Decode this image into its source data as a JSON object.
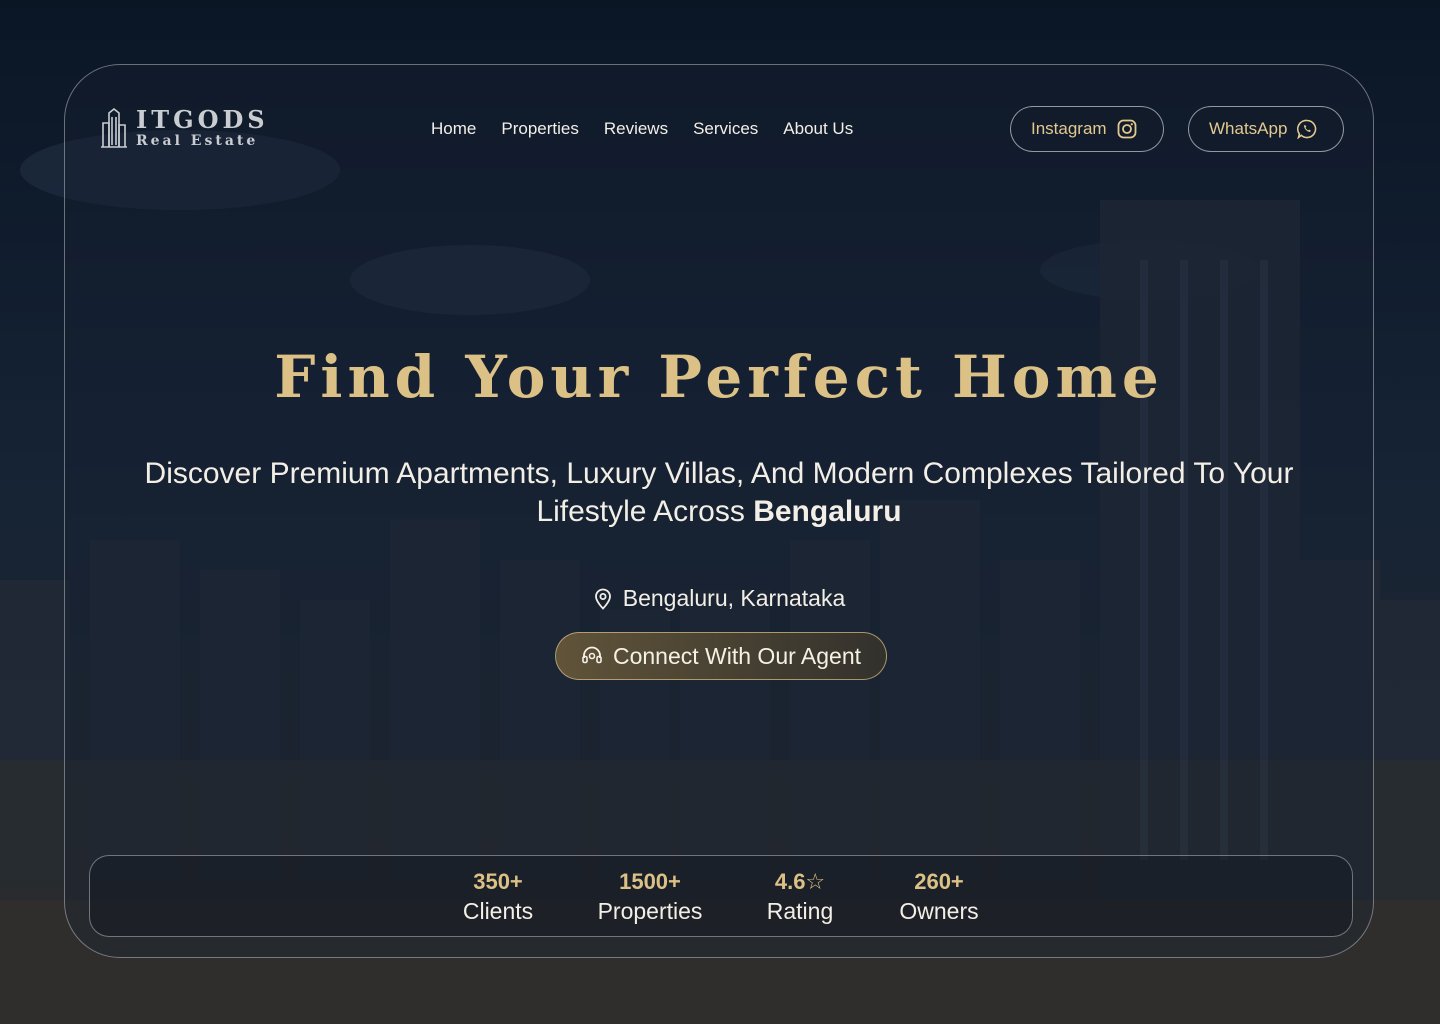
{
  "brand": {
    "name": "ITGODS",
    "tagline": "Real Estate"
  },
  "nav": {
    "items": [
      "Home",
      "Properties",
      "Reviews",
      "Services",
      "About Us"
    ]
  },
  "social": {
    "instagram_label": "Instagram",
    "whatsapp_label": "WhatsApp"
  },
  "hero": {
    "title": "Find Your Perfect Home",
    "subtitle": "Discover Premium Apartments, Luxury Villas, And Modern Complexes Tailored To Your Lifestyle Across",
    "subtitle_bold": "Bengaluru",
    "location": "Bengaluru, Karnataka",
    "cta_label": "Connect With Our Agent"
  },
  "stats": [
    {
      "value": "350+",
      "label": "Clients"
    },
    {
      "value": "1500+",
      "label": "Properties"
    },
    {
      "value": "4.6☆",
      "label": "Rating"
    },
    {
      "value": "260+",
      "label": "Owners"
    }
  ],
  "colors": {
    "accent_gold": "#dcc186",
    "text": "#f3efe6",
    "background": "#0c1626"
  }
}
